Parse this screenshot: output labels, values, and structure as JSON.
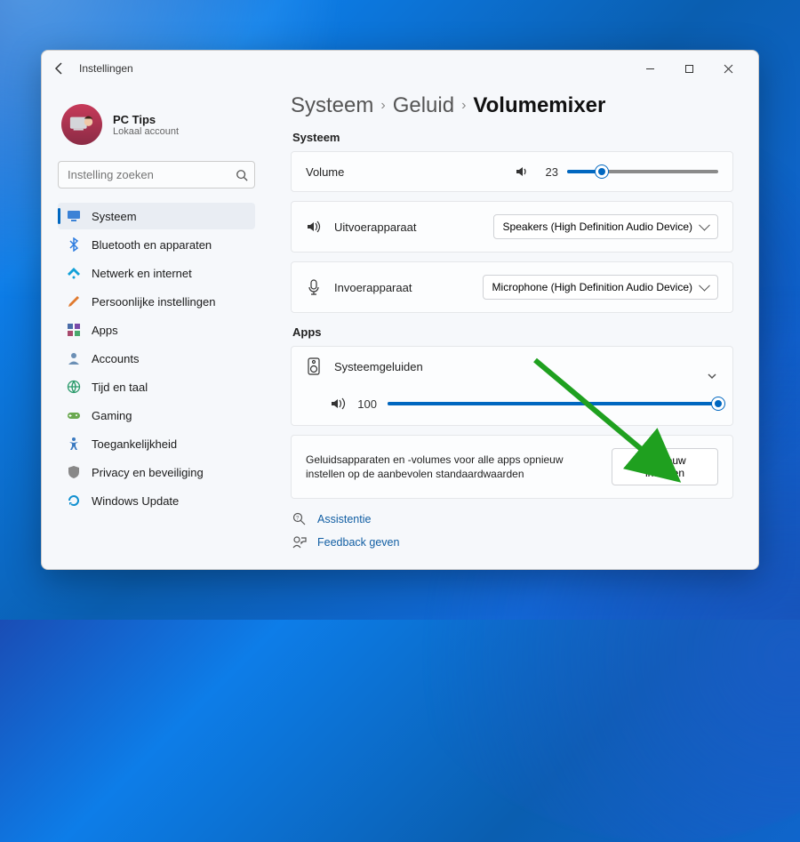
{
  "window": {
    "title": "Instellingen"
  },
  "profile": {
    "name": "PC Tips",
    "subtitle": "Lokaal account"
  },
  "search": {
    "placeholder": "Instelling zoeken"
  },
  "sidebar": {
    "items": [
      {
        "label": "Systeem",
        "icon": "monitor-icon",
        "active": true
      },
      {
        "label": "Bluetooth en apparaten",
        "icon": "bluetooth-icon"
      },
      {
        "label": "Netwerk en internet",
        "icon": "wifi-icon"
      },
      {
        "label": "Persoonlijke instellingen",
        "icon": "brush-icon"
      },
      {
        "label": "Apps",
        "icon": "apps-icon"
      },
      {
        "label": "Accounts",
        "icon": "person-icon"
      },
      {
        "label": "Tijd en taal",
        "icon": "globe-clock-icon"
      },
      {
        "label": "Gaming",
        "icon": "gamepad-icon"
      },
      {
        "label": "Toegankelijkheid",
        "icon": "accessibility-icon"
      },
      {
        "label": "Privacy en beveiliging",
        "icon": "shield-icon"
      },
      {
        "label": "Windows Update",
        "icon": "update-icon"
      }
    ]
  },
  "breadcrumb": {
    "level1": "Systeem",
    "level2": "Geluid",
    "current": "Volumemixer"
  },
  "sections": {
    "system_label": "Systeem",
    "apps_label": "Apps"
  },
  "volume": {
    "label": "Volume",
    "value": 23
  },
  "output": {
    "label": "Uitvoerapparaat",
    "selected": "Speakers (High Definition Audio Device)"
  },
  "input": {
    "label": "Invoerapparaat",
    "selected": "Microphone (High Definition Audio Device)"
  },
  "app_item": {
    "name": "Systeemgeluiden",
    "volume": 100
  },
  "reset": {
    "description": "Geluidsapparaten en -volumes voor alle apps opnieuw instellen op de aanbevolen standaardwaarden",
    "button": "Opnieuw instellen"
  },
  "footer": {
    "help": "Assistentie",
    "feedback": "Feedback geven"
  },
  "colors": {
    "accent": "#0067c0"
  }
}
